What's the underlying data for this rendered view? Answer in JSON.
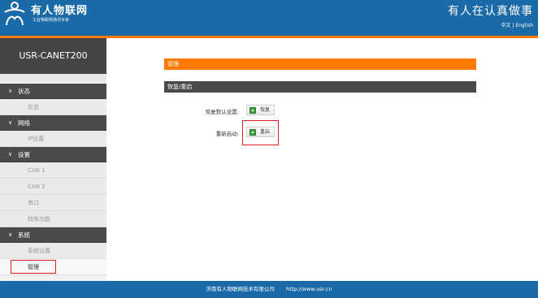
{
  "header": {
    "brand_name": "有人物联网",
    "brand_sub": "工业物联网通讯专家",
    "slogan": "有人在认真做事",
    "lang_zh": "中文",
    "lang_sep": "|",
    "lang_en": "English"
  },
  "sidebar": {
    "title": "USR-CANET200",
    "sections": [
      {
        "label": "状态",
        "items": [
          "总览"
        ]
      },
      {
        "label": "网络",
        "items": [
          "IP设置"
        ]
      },
      {
        "label": "设置",
        "items": [
          "CAN 1",
          "CAN 2",
          "串口",
          "特殊功能"
        ]
      },
      {
        "label": "系统",
        "items": [
          "系统设置",
          "管理"
        ]
      }
    ],
    "active_item": "管理"
  },
  "main": {
    "section_title": "管理",
    "sub_title": "恢复/重启",
    "restore_label": "恢复默认设置:",
    "restore_button": "恢复",
    "reboot_label": "重新启动:",
    "reboot_button": "重启"
  },
  "footer": {
    "company": "济南有人物联网技术有限公司",
    "url": "http://www.usr.cn"
  },
  "colors": {
    "header_blue": "#1a6aa8",
    "accent_orange": "#ff7800",
    "dark_bar": "#4a4a4a",
    "highlight_red": "#e02020",
    "button_icon_green": "#3aa33a"
  },
  "icons": [
    "usr-logo-icon",
    "chevron-down-icon",
    "restore-icon",
    "reboot-icon"
  ]
}
